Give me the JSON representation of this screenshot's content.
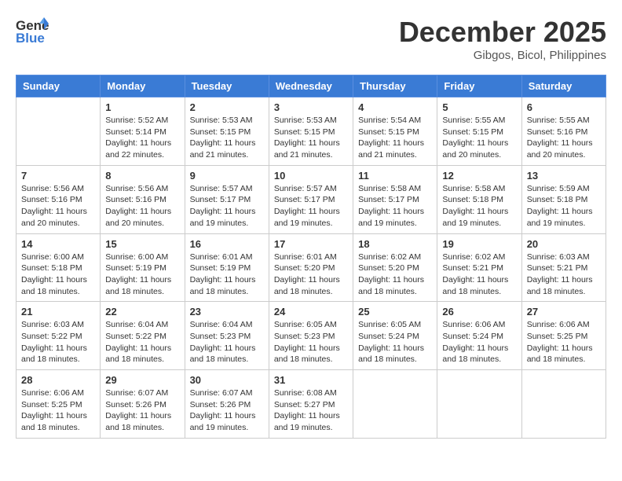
{
  "header": {
    "logo_general": "General",
    "logo_blue": "Blue",
    "month": "December 2025",
    "location": "Gibgos, Bicol, Philippines"
  },
  "weekdays": [
    "Sunday",
    "Monday",
    "Tuesday",
    "Wednesday",
    "Thursday",
    "Friday",
    "Saturday"
  ],
  "weeks": [
    [
      {
        "day": "",
        "info": ""
      },
      {
        "day": "1",
        "info": "Sunrise: 5:52 AM\nSunset: 5:14 PM\nDaylight: 11 hours\nand 22 minutes."
      },
      {
        "day": "2",
        "info": "Sunrise: 5:53 AM\nSunset: 5:15 PM\nDaylight: 11 hours\nand 21 minutes."
      },
      {
        "day": "3",
        "info": "Sunrise: 5:53 AM\nSunset: 5:15 PM\nDaylight: 11 hours\nand 21 minutes."
      },
      {
        "day": "4",
        "info": "Sunrise: 5:54 AM\nSunset: 5:15 PM\nDaylight: 11 hours\nand 21 minutes."
      },
      {
        "day": "5",
        "info": "Sunrise: 5:55 AM\nSunset: 5:15 PM\nDaylight: 11 hours\nand 20 minutes."
      },
      {
        "day": "6",
        "info": "Sunrise: 5:55 AM\nSunset: 5:16 PM\nDaylight: 11 hours\nand 20 minutes."
      }
    ],
    [
      {
        "day": "7",
        "info": "Sunrise: 5:56 AM\nSunset: 5:16 PM\nDaylight: 11 hours\nand 20 minutes."
      },
      {
        "day": "8",
        "info": "Sunrise: 5:56 AM\nSunset: 5:16 PM\nDaylight: 11 hours\nand 20 minutes."
      },
      {
        "day": "9",
        "info": "Sunrise: 5:57 AM\nSunset: 5:17 PM\nDaylight: 11 hours\nand 19 minutes."
      },
      {
        "day": "10",
        "info": "Sunrise: 5:57 AM\nSunset: 5:17 PM\nDaylight: 11 hours\nand 19 minutes."
      },
      {
        "day": "11",
        "info": "Sunrise: 5:58 AM\nSunset: 5:17 PM\nDaylight: 11 hours\nand 19 minutes."
      },
      {
        "day": "12",
        "info": "Sunrise: 5:58 AM\nSunset: 5:18 PM\nDaylight: 11 hours\nand 19 minutes."
      },
      {
        "day": "13",
        "info": "Sunrise: 5:59 AM\nSunset: 5:18 PM\nDaylight: 11 hours\nand 19 minutes."
      }
    ],
    [
      {
        "day": "14",
        "info": "Sunrise: 6:00 AM\nSunset: 5:18 PM\nDaylight: 11 hours\nand 18 minutes."
      },
      {
        "day": "15",
        "info": "Sunrise: 6:00 AM\nSunset: 5:19 PM\nDaylight: 11 hours\nand 18 minutes."
      },
      {
        "day": "16",
        "info": "Sunrise: 6:01 AM\nSunset: 5:19 PM\nDaylight: 11 hours\nand 18 minutes."
      },
      {
        "day": "17",
        "info": "Sunrise: 6:01 AM\nSunset: 5:20 PM\nDaylight: 11 hours\nand 18 minutes."
      },
      {
        "day": "18",
        "info": "Sunrise: 6:02 AM\nSunset: 5:20 PM\nDaylight: 11 hours\nand 18 minutes."
      },
      {
        "day": "19",
        "info": "Sunrise: 6:02 AM\nSunset: 5:21 PM\nDaylight: 11 hours\nand 18 minutes."
      },
      {
        "day": "20",
        "info": "Sunrise: 6:03 AM\nSunset: 5:21 PM\nDaylight: 11 hours\nand 18 minutes."
      }
    ],
    [
      {
        "day": "21",
        "info": "Sunrise: 6:03 AM\nSunset: 5:22 PM\nDaylight: 11 hours\nand 18 minutes."
      },
      {
        "day": "22",
        "info": "Sunrise: 6:04 AM\nSunset: 5:22 PM\nDaylight: 11 hours\nand 18 minutes."
      },
      {
        "day": "23",
        "info": "Sunrise: 6:04 AM\nSunset: 5:23 PM\nDaylight: 11 hours\nand 18 minutes."
      },
      {
        "day": "24",
        "info": "Sunrise: 6:05 AM\nSunset: 5:23 PM\nDaylight: 11 hours\nand 18 minutes."
      },
      {
        "day": "25",
        "info": "Sunrise: 6:05 AM\nSunset: 5:24 PM\nDaylight: 11 hours\nand 18 minutes."
      },
      {
        "day": "26",
        "info": "Sunrise: 6:06 AM\nSunset: 5:24 PM\nDaylight: 11 hours\nand 18 minutes."
      },
      {
        "day": "27",
        "info": "Sunrise: 6:06 AM\nSunset: 5:25 PM\nDaylight: 11 hours\nand 18 minutes."
      }
    ],
    [
      {
        "day": "28",
        "info": "Sunrise: 6:06 AM\nSunset: 5:25 PM\nDaylight: 11 hours\nand 18 minutes."
      },
      {
        "day": "29",
        "info": "Sunrise: 6:07 AM\nSunset: 5:26 PM\nDaylight: 11 hours\nand 18 minutes."
      },
      {
        "day": "30",
        "info": "Sunrise: 6:07 AM\nSunset: 5:26 PM\nDaylight: 11 hours\nand 19 minutes."
      },
      {
        "day": "31",
        "info": "Sunrise: 6:08 AM\nSunset: 5:27 PM\nDaylight: 11 hours\nand 19 minutes."
      },
      {
        "day": "",
        "info": ""
      },
      {
        "day": "",
        "info": ""
      },
      {
        "day": "",
        "info": ""
      }
    ]
  ]
}
